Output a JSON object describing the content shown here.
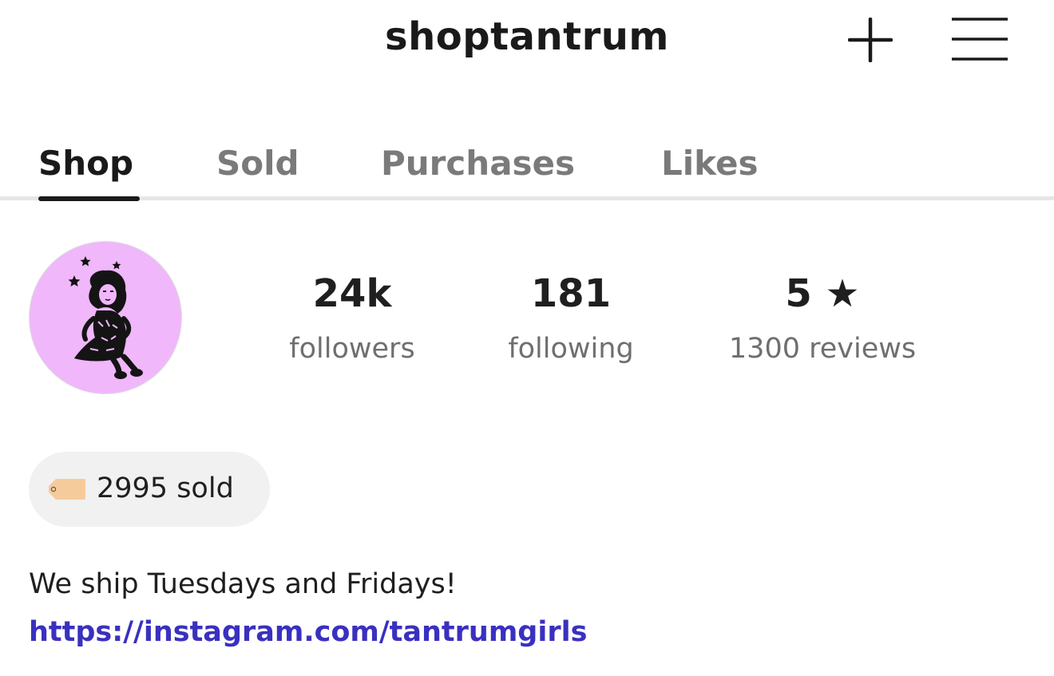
{
  "header": {
    "username": "shoptantrum",
    "add_icon": "plus-icon",
    "menu_icon": "hamburger-menu-icon"
  },
  "tabs": [
    {
      "label": "Shop",
      "active": true
    },
    {
      "label": "Sold",
      "active": false
    },
    {
      "label": "Purchases",
      "active": false
    },
    {
      "label": "Likes",
      "active": false
    }
  ],
  "profile": {
    "avatar_background": "#f0b7fb",
    "stats": [
      {
        "value": "24k",
        "label": "followers"
      },
      {
        "value": "181",
        "label": "following"
      },
      {
        "value": "5 ★",
        "label": "1300 reviews"
      }
    ],
    "sold_badge": {
      "icon": "price-tag-icon",
      "text": "2995 sold"
    },
    "bio": "We ship Tuesdays and Fridays!",
    "link": "https://instagram.com/tantrumgirls"
  },
  "colors": {
    "text_primary": "#1a1a1a",
    "text_secondary": "#6f6f6f",
    "tab_inactive": "#7a7a7a",
    "link": "#3a30c0",
    "badge_bg": "#f1f1f1",
    "tag_fill": "#f6cb9b"
  }
}
